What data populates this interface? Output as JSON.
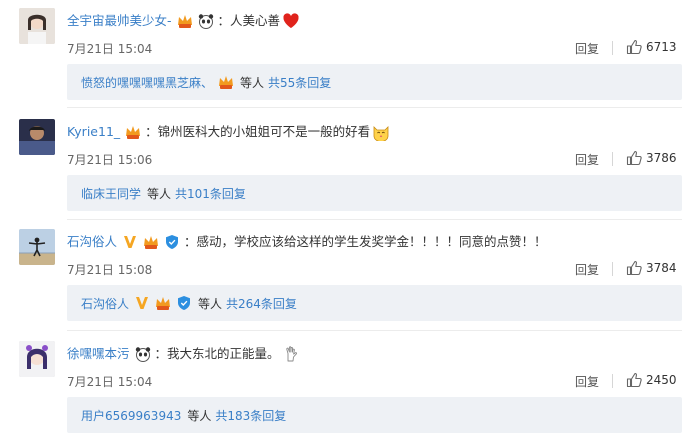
{
  "comments": [
    {
      "username": "全宇宙最帅美少女-",
      "text": "：人美心善",
      "time": "7月21日 15:04",
      "reply_label": "回复",
      "likes": "6713",
      "reply_preview": {
        "users": "愤怒的嘿嘿嘿嘿黑芝麻、",
        "etc": "等人",
        "total": "共55条回复"
      }
    },
    {
      "username": "Kyrie11_",
      "text": "：锦州医科大的小姐姐可不是一般的好看",
      "time": "7月21日 15:06",
      "reply_label": "回复",
      "likes": "3786",
      "reply_preview": {
        "users": "临床王同学",
        "etc": "等人",
        "total": "共101条回复"
      }
    },
    {
      "username": "石沟俗人",
      "text": "：感动，学校应该给这样的学生发奖学金！！！！同意的点赞！！",
      "time": "7月21日 15:08",
      "reply_label": "回复",
      "likes": "3784",
      "reply_preview": {
        "users": "石沟俗人",
        "etc": "等人",
        "total": "共264条回复"
      }
    },
    {
      "username": "徐嘿嘿本污",
      "text": "：我大东北的正能量。",
      "time": "7月21日 15:04",
      "reply_label": "回复",
      "likes": "2450",
      "reply_preview": {
        "users": "用户6569963943",
        "etc": "等人",
        "total": "共183条回复"
      }
    }
  ],
  "colors": {
    "link": "#3a7fc7",
    "reply_box": "#eef1f5",
    "badge_orange": "#f29a1f",
    "verified_v": "#f5a623",
    "shield_blue": "#2c8fe0"
  }
}
